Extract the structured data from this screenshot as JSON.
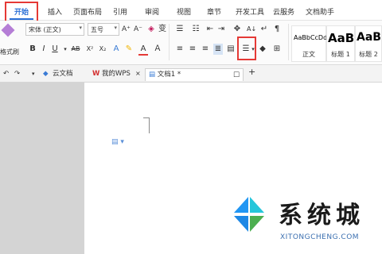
{
  "menu": {
    "tabs": [
      "开始",
      "插入",
      "页面布局",
      "引用",
      "审阅",
      "视图",
      "章节",
      "开发工具",
      "云服务",
      "文档助手"
    ],
    "active_tab": "开始"
  },
  "ribbon": {
    "format_painter_label": "格式刷",
    "font_name": "宋体 (正文)",
    "font_size": "五号",
    "bold": "B",
    "italic": "I",
    "underline": "U",
    "strike": "AB",
    "superscript": "X²",
    "subscript": "X₂",
    "font_color_letter": "A",
    "styles": [
      {
        "sample": "AaBbCcDd",
        "caption": "正文"
      },
      {
        "sample": "AaBl",
        "caption": "标题 1"
      },
      {
        "sample": "AaBb",
        "caption": "标题 2"
      }
    ]
  },
  "doc_tabs": {
    "cloud": "云文档",
    "my_wps": "我的WPS",
    "doc1": "文档1 *",
    "add": "+"
  },
  "watermark": {
    "brand": "系统城",
    "url": "XITONGCHENG.COM"
  },
  "colors": {
    "accent": "#2b6fd6",
    "highlight": "#e53935",
    "wps_red": "#d32f2f"
  }
}
